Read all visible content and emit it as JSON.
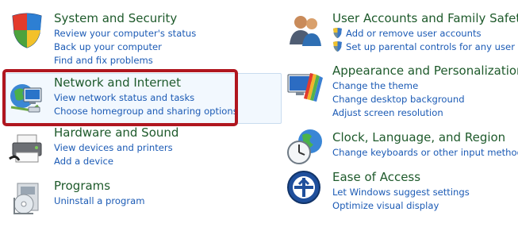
{
  "categories": {
    "system_security": {
      "title": "System and Security",
      "links": [
        "Review your computer's status",
        "Back up your computer",
        "Find and fix problems"
      ]
    },
    "network_internet": {
      "title": "Network and Internet",
      "links": [
        "View network status and tasks",
        "Choose homegroup and sharing options"
      ]
    },
    "hardware_sound": {
      "title": "Hardware and Sound",
      "links": [
        "View devices and printers",
        "Add a device"
      ]
    },
    "programs": {
      "title": "Programs",
      "links": [
        "Uninstall a program"
      ]
    },
    "user_accounts": {
      "title": "User Accounts and Family Safety",
      "links": [
        "Add or remove user accounts",
        "Set up parental controls for any user"
      ]
    },
    "appearance": {
      "title": "Appearance and Personalization",
      "links": [
        "Change the theme",
        "Change desktop background",
        "Adjust screen resolution"
      ]
    },
    "clock_language": {
      "title": "Clock, Language, and Region",
      "links": [
        "Change keyboards or other input methods"
      ]
    },
    "ease_access": {
      "title": "Ease of Access",
      "links": [
        "Let Windows suggest settings",
        "Optimize visual display"
      ]
    }
  },
  "icons": {
    "system_security": "shield-icon",
    "network_internet": "network-globe-icon",
    "hardware_sound": "printer-icon",
    "programs": "programs-icon",
    "user_accounts": "users-icon",
    "appearance": "display-palette-icon",
    "clock_language": "clock-globe-icon",
    "ease_access": "ease-of-access-icon",
    "uac": "uac-shield-icon"
  },
  "colors": {
    "title": "#1e5a2b",
    "link": "#1c5bb5",
    "highlight": "#b0161f",
    "hover_fill": "#f2f8fe"
  }
}
